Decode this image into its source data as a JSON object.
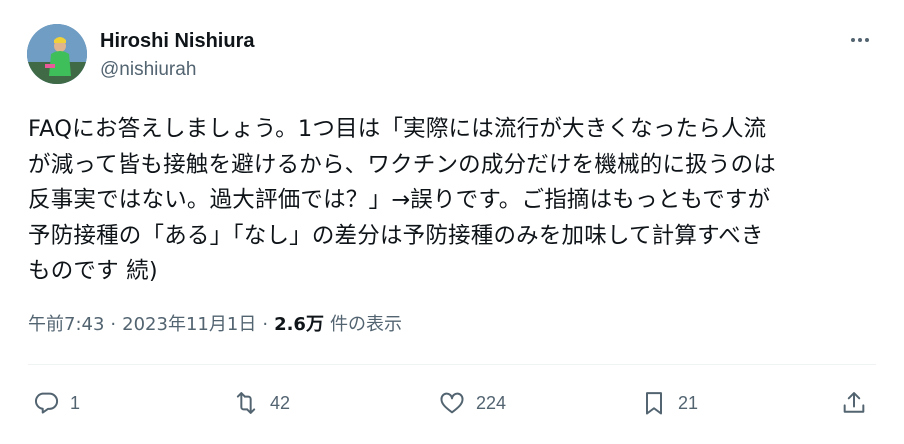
{
  "author": {
    "name": "Hiroshi Nishiura",
    "handle": "@nishiurah",
    "avatar_icon": "avatar-runner-photo"
  },
  "tweet": {
    "text": "FAQにお答えしましょう。1つ目は「実際には流行が大きくなったら人流\nが減って皆も接触を避けるから、ワクチンの成分だけを機械的に扱うのは\n反事実ではない。過大評価では？」→誤りです。ご指摘はもっともですが\n予防接種の「ある」「なし」の差分は予防接種のみを加味して計算すべき\nものです 続)"
  },
  "meta": {
    "time": "午前7:43",
    "date": "2023年11月1日",
    "separator": "·",
    "views_count": "2.6万",
    "views_label": "件の表示"
  },
  "actions": {
    "reply_count": "1",
    "retweet_count": "42",
    "like_count": "224",
    "bookmark_count": "21"
  },
  "icons": {
    "more": "more-dots-icon",
    "reply": "reply-icon",
    "retweet": "retweet-icon",
    "like": "heart-icon",
    "bookmark": "bookmark-icon",
    "share": "share-icon"
  },
  "colors": {
    "text": "#0f1419",
    "secondary": "#536471",
    "divider": "#eff3f4"
  }
}
